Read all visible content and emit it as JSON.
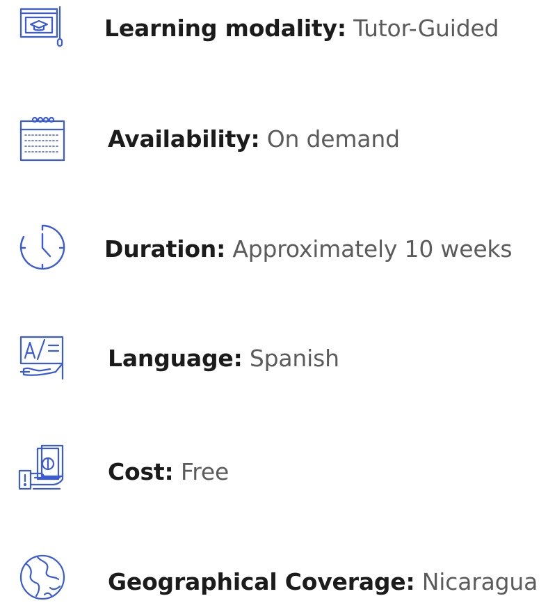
{
  "features": [
    {
      "icon": "online-course-icon",
      "label": "Learning modality:",
      "value": "Tutor-Guided"
    },
    {
      "icon": "calendar-icon",
      "label": "Availability:",
      "value": "On demand"
    },
    {
      "icon": "clock-icon",
      "label": "Duration:",
      "value": "Approximately 10 weeks"
    },
    {
      "icon": "translation-icon",
      "label": "Language:",
      "value": "Spanish"
    },
    {
      "icon": "cash-in-hand-icon",
      "label": "Cost:",
      "value": "Free"
    },
    {
      "icon": "globe-icon",
      "label": "Geographical Coverage:",
      "value": "Nicaragua"
    }
  ],
  "colors": {
    "icon_stroke": "#3a5bd9",
    "label_text": "#1b1b1b",
    "value_text": "#5b5b5b"
  }
}
